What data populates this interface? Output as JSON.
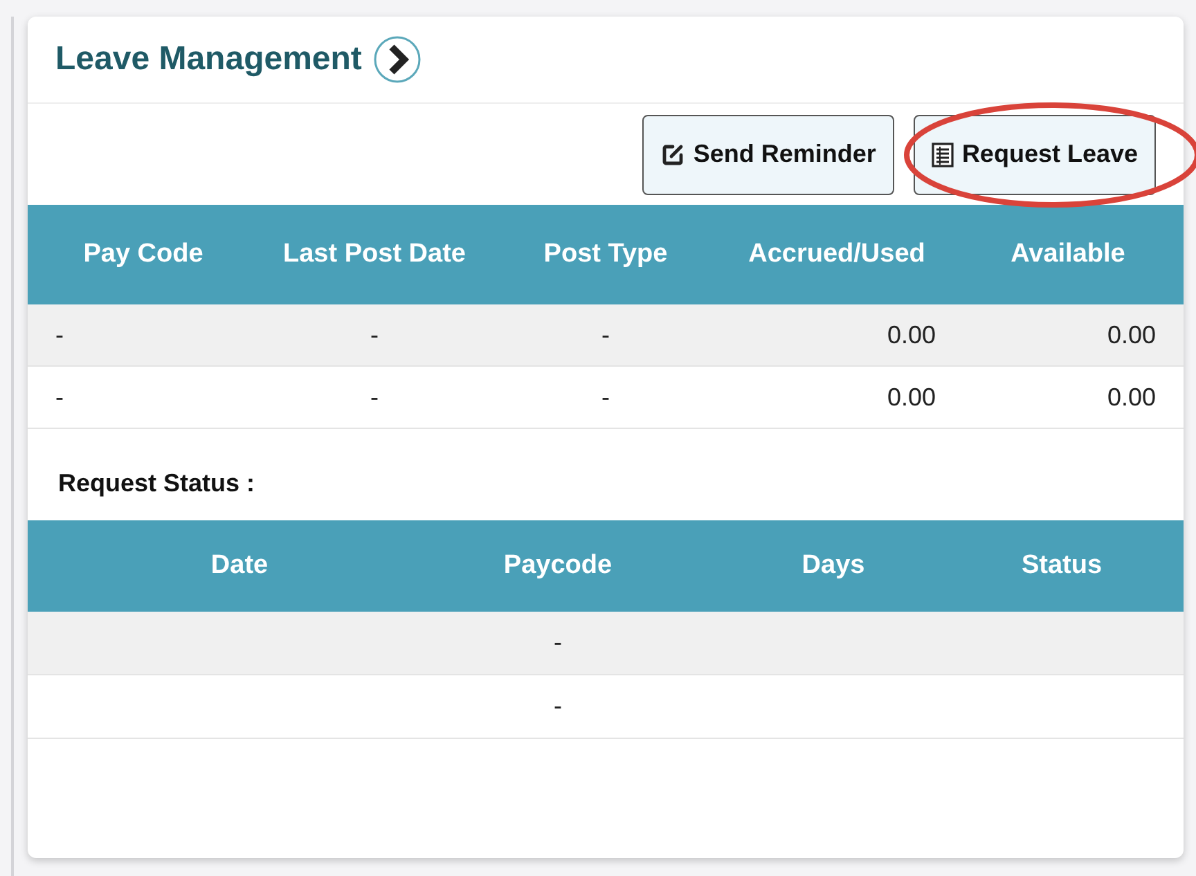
{
  "panel": {
    "title": "Leave Management"
  },
  "actions": [
    {
      "label": "Send Reminder",
      "kind": "reminder",
      "highlighted": false
    },
    {
      "label": "Request Leave",
      "kind": "request",
      "highlighted": true
    }
  ],
  "balances": {
    "columns": [
      "Pay Code",
      "Last Post Date",
      "Post Type",
      "Accrued/Used",
      "Available"
    ],
    "rows": [
      [
        "-",
        "-",
        "-",
        "0.00",
        "0.00"
      ],
      [
        "-",
        "-",
        "-",
        "0.00",
        "0.00"
      ]
    ]
  },
  "request_status": {
    "label": "Request Status :",
    "columns": [
      "Date",
      "Paycode",
      "Days",
      "Status"
    ],
    "rows": [
      {
        "paycode": "-"
      },
      {
        "paycode": "-"
      }
    ]
  }
}
